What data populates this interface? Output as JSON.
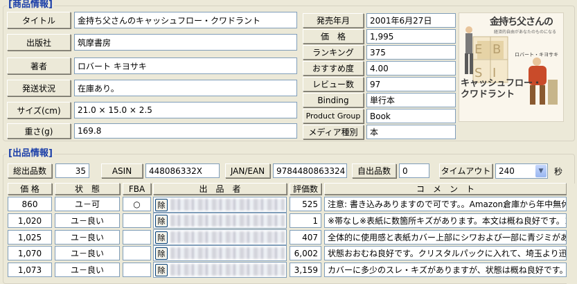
{
  "product_section": {
    "title": "[商品情報]",
    "rows": [
      {
        "label": "タイトル",
        "value": "金持ち父さんのキャッシュフロー・クワドラント"
      },
      {
        "label": "出版社",
        "value": "筑摩書房"
      },
      {
        "label": "著者",
        "value": "ロバート キヨサキ"
      },
      {
        "label": "発送状況",
        "value": "在庫あり。"
      },
      {
        "label": "サイズ(cm)",
        "value": "21.0 × 15.0 × 2.5"
      },
      {
        "label": "重さ(g)",
        "value": "169.8"
      }
    ],
    "right_rows": [
      {
        "label": "発売年月",
        "value": "2001年6月27日"
      },
      {
        "label": "価　格",
        "value": "1,995"
      },
      {
        "label": "ランキング",
        "value": "375"
      },
      {
        "label": "おすすめ度",
        "value": "4.00"
      },
      {
        "label": "レビュー数",
        "value": "97"
      },
      {
        "label": "Binding",
        "value": "単行本"
      },
      {
        "label": "Product Group",
        "value": "Book"
      },
      {
        "label": "メディア種別",
        "value": "本"
      }
    ],
    "cover": {
      "title_top": "金持ち父さんの",
      "subtitle": "経済的自由があなたのものになる",
      "author": "ロバート・キヨサキ",
      "title_bottom_1": "キャッシュフロー・",
      "title_bottom_2": "クワドラント"
    }
  },
  "listing_section": {
    "title": "[出品情報]",
    "summary": {
      "total_label": "総出品数",
      "total_value": "35",
      "asin_label": "ASIN",
      "asin_value": "448086332X",
      "jan_label": "JAN/EAN",
      "jan_value": "9784480863324",
      "own_label": "自出品数",
      "own_value": "0",
      "timeout_label": "タイムアウト",
      "timeout_value": "240",
      "timeout_unit": "秒"
    },
    "columns": {
      "price": "価 格",
      "condition": "状　態",
      "fba": "FBA",
      "seller": "出　品　者",
      "rating": "評価数",
      "comment": "コ　メ　ン　ト"
    },
    "remove_label": "除",
    "rows": [
      {
        "price": "860",
        "condition": "ユ－可",
        "fba": "○",
        "rating": "525",
        "comment": "注意: 書き込みありますので可です。。Amazon倉庫から年中無休即"
      },
      {
        "price": "1,020",
        "condition": "ユ－良い",
        "fba": "",
        "rating": "1",
        "comment": "※帯なし※表紙に数箇所キズがあります。本文は概ね良好です。ヨ"
      },
      {
        "price": "1,025",
        "condition": "ユ－良い",
        "fba": "",
        "rating": "407",
        "comment": "全体的に使用感と表紙カバー上部にシワおよび一部に青ジミがありま"
      },
      {
        "price": "1,070",
        "condition": "ユ－良い",
        "fba": "",
        "rating": "6,002",
        "comment": "状態おおむね良好です。クリスタルパックに入れて、埼玉より迅速に発"
      },
      {
        "price": "1,073",
        "condition": "ユ－良い",
        "fba": "",
        "rating": "3,159",
        "comment": "カバーに多少のスレ・キズがありますが、状態は概ね良好です。帯付き"
      }
    ]
  }
}
